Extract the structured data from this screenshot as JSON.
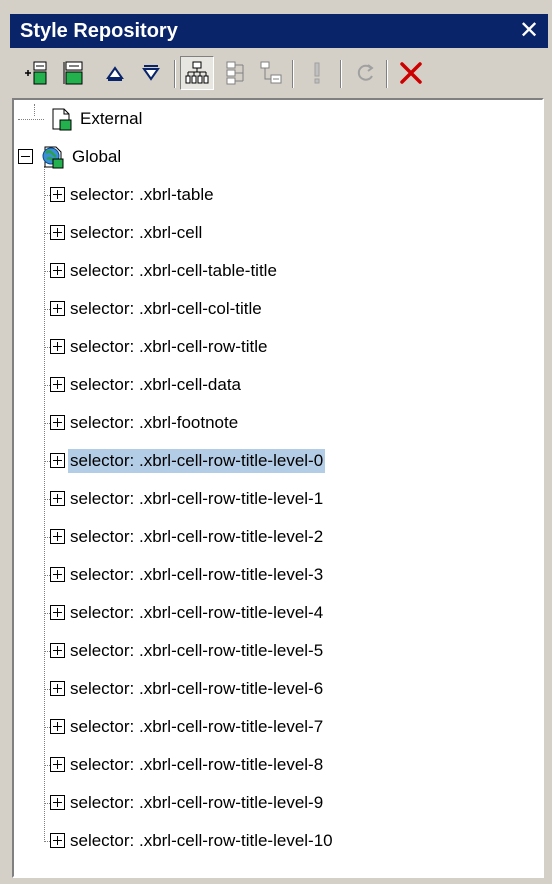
{
  "window": {
    "title": "Style Repository",
    "close_glyph": "✕"
  },
  "toolbar": {
    "buttons": [
      {
        "icon": "add-external-stylesheet-icon"
      },
      {
        "icon": "add-global-stylesheet-icon"
      },
      {
        "icon": "move-up-icon"
      },
      {
        "icon": "move-down-icon"
      },
      {
        "icon": "view-by-tree-icon",
        "pressed": true
      },
      {
        "icon": "view-by-list-icon"
      },
      {
        "icon": "view-by-cascade-icon"
      },
      {
        "icon": "mark-important-icon"
      },
      {
        "icon": "reload-icon"
      },
      {
        "icon": "delete-icon"
      }
    ]
  },
  "tree": {
    "external_label": "External",
    "global_label": "Global",
    "selected_index": 7,
    "selectors": [
      "selector: .xbrl-table",
      "selector: .xbrl-cell",
      "selector: .xbrl-cell-table-title",
      "selector: .xbrl-cell-col-title",
      "selector: .xbrl-cell-row-title",
      "selector: .xbrl-cell-data",
      "selector: .xbrl-footnote",
      "selector: .xbrl-cell-row-title-level-0",
      "selector: .xbrl-cell-row-title-level-1",
      "selector: .xbrl-cell-row-title-level-2",
      "selector: .xbrl-cell-row-title-level-3",
      "selector: .xbrl-cell-row-title-level-4",
      "selector: .xbrl-cell-row-title-level-5",
      "selector: .xbrl-cell-row-title-level-6",
      "selector: .xbrl-cell-row-title-level-7",
      "selector: .xbrl-cell-row-title-level-8",
      "selector: .xbrl-cell-row-title-level-9",
      "selector: .xbrl-cell-row-title-level-10"
    ]
  },
  "colors": {
    "title_bar": "#0a246a",
    "selection": "#b4cde6",
    "panel": "#d4d0c8",
    "delete_red": "#cc0000"
  }
}
